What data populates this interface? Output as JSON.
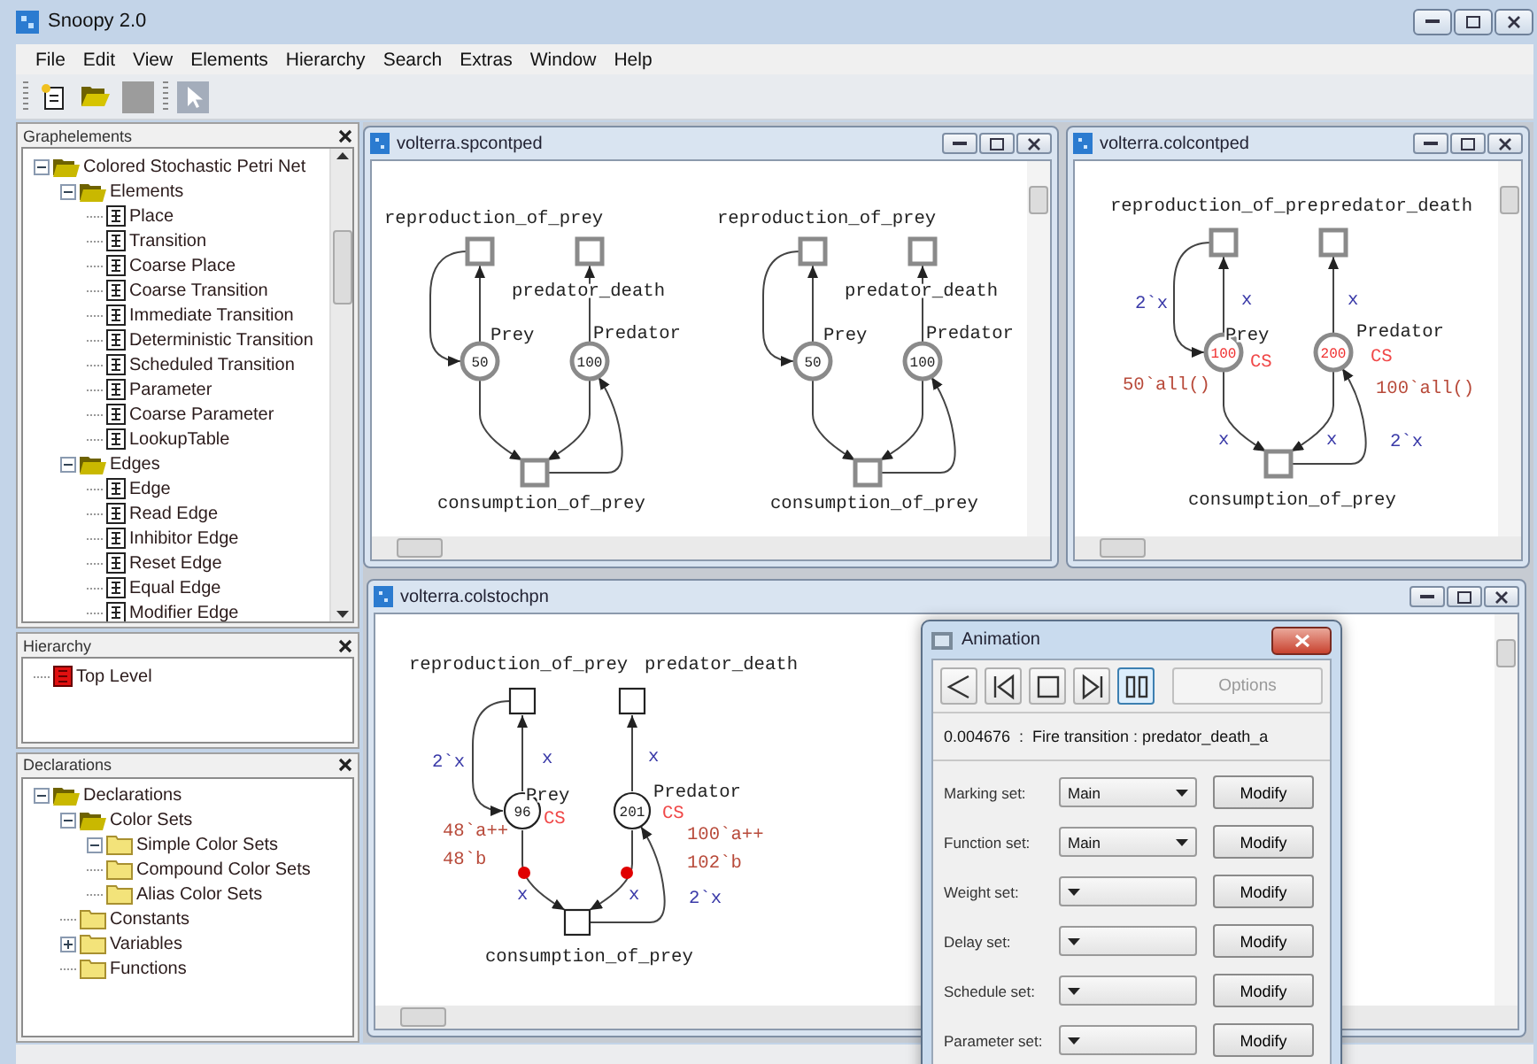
{
  "app": {
    "title": "Snoopy 2.0"
  },
  "menu": [
    "File",
    "Edit",
    "View",
    "Elements",
    "Hierarchy",
    "Search",
    "Extras",
    "Window",
    "Help"
  ],
  "toolbar": [
    {
      "kind": "new"
    },
    {
      "kind": "open"
    },
    {
      "kind": "save",
      "disabled": true
    },
    {
      "kind": "pointer"
    }
  ],
  "docks": [
    {
      "title": "Graphelements",
      "scrollable": true,
      "tree": [
        {
          "label": "Colored Stochastic Petri Net",
          "kind": "folder-open",
          "expanded": true,
          "children": [
            {
              "label": "Elements",
              "kind": "folder-open",
              "expanded": true,
              "children": [
                {
                  "label": "Place",
                  "kind": "doc"
                },
                {
                  "label": "Transition",
                  "kind": "doc"
                },
                {
                  "label": "Coarse Place",
                  "kind": "doc"
                },
                {
                  "label": "Coarse Transition",
                  "kind": "doc"
                },
                {
                  "label": "Immediate Transition",
                  "kind": "doc"
                },
                {
                  "label": "Deterministic Transition",
                  "kind": "doc"
                },
                {
                  "label": "Scheduled Transition",
                  "kind": "doc"
                },
                {
                  "label": "Parameter",
                  "kind": "doc"
                },
                {
                  "label": "Coarse Parameter",
                  "kind": "doc"
                },
                {
                  "label": "LookupTable",
                  "kind": "doc"
                }
              ]
            },
            {
              "label": "Edges",
              "kind": "folder-open",
              "expanded": true,
              "children": [
                {
                  "label": "Edge",
                  "kind": "doc"
                },
                {
                  "label": "Read Edge",
                  "kind": "doc"
                },
                {
                  "label": "Inhibitor Edge",
                  "kind": "doc"
                },
                {
                  "label": "Reset Edge",
                  "kind": "doc"
                },
                {
                  "label": "Equal Edge",
                  "kind": "doc"
                },
                {
                  "label": "Modifier Edge",
                  "kind": "doc"
                }
              ]
            }
          ]
        }
      ]
    },
    {
      "title": "Hierarchy",
      "tree": [
        {
          "label": "Top Level",
          "kind": "doc-red"
        }
      ]
    },
    {
      "title": "Declarations",
      "tree": [
        {
          "label": "Declarations",
          "kind": "folder-open",
          "expanded": true,
          "children": [
            {
              "label": "Color Sets",
              "kind": "folder-open",
              "expanded": true,
              "children": [
                {
                  "label": "Simple Color Sets",
                  "kind": "folder",
                  "expanded": true
                },
                {
                  "label": "Compound Color Sets",
                  "kind": "folder"
                },
                {
                  "label": "Alias Color Sets",
                  "kind": "folder"
                }
              ]
            },
            {
              "label": "Constants",
              "kind": "folder"
            },
            {
              "label": "Variables",
              "kind": "folder",
              "expanded": false
            },
            {
              "label": "Functions",
              "kind": "folder"
            }
          ]
        }
      ]
    }
  ],
  "windows": [
    {
      "title": "volterra.spcontped",
      "nets": [
        {
          "kind": "plain",
          "transitions": [
            "reproduction_of_prey",
            "predator_death",
            "consumption_of_prey"
          ],
          "places": [
            {
              "name": "Prey",
              "marking": "50"
            },
            {
              "name": "Predator",
              "marking": "100"
            }
          ]
        },
        {
          "kind": "plain",
          "transitions": [
            "reproduction_of_prey",
            "predator_death",
            "consumption_of_prey"
          ],
          "places": [
            {
              "name": "Prey",
              "marking": "50"
            },
            {
              "name": "Predator",
              "marking": "100"
            }
          ]
        }
      ]
    },
    {
      "title": "volterra.colcontped",
      "nets": [
        {
          "kind": "colored",
          "transitions": [
            "reproduction_of_pre",
            "predator_death",
            "consumption_of_prey"
          ],
          "places": [
            {
              "name": "Prey",
              "marking": "100",
              "color_set": "CS",
              "initial": [
                "50`all()"
              ]
            },
            {
              "name": "Predator",
              "marking": "200",
              "color_set": "CS",
              "initial": [
                "100`all()"
              ]
            }
          ],
          "arc_inscriptions": [
            "2`x",
            "x",
            "x",
            "x",
            "x",
            "2`x"
          ]
        }
      ]
    },
    {
      "title": "volterra.colstochpn",
      "nets": [
        {
          "kind": "stochastic",
          "tokens_in_transit": true,
          "transitions": [
            "reproduction_of_prey",
            "predator_death",
            "consumption_of_prey"
          ],
          "places": [
            {
              "name": "Prey",
              "marking": "96",
              "color_set": "CS",
              "initial": [
                "48`a++",
                "48`b"
              ]
            },
            {
              "name": "Predator",
              "marking": "201",
              "color_set": "CS",
              "initial": [
                "100`a++",
                "102`b"
              ]
            }
          ],
          "arc_inscriptions": [
            "2`x",
            "x",
            "x",
            "x",
            "x",
            "2`x"
          ]
        }
      ]
    }
  ],
  "animation": {
    "title": "Animation",
    "controls": [
      {
        "kind": "back",
        "selected": false
      },
      {
        "kind": "step-back",
        "selected": false
      },
      {
        "kind": "stop",
        "selected": false
      },
      {
        "kind": "step-forward",
        "selected": false
      },
      {
        "kind": "pause",
        "selected": true
      }
    ],
    "options": {
      "label": "Options",
      "disabled": true
    },
    "status": "0.004676  :  Fire transition : predator_death_a",
    "sets": [
      {
        "label": "Marking set:",
        "value": "Main",
        "button": "Modify"
      },
      {
        "label": "Function set:",
        "value": "Main",
        "button": "Modify"
      },
      {
        "label": "Weight set:",
        "button": "Modify"
      },
      {
        "label": "Delay set:",
        "button": "Modify"
      },
      {
        "label": "Schedule set:",
        "button": "Modify"
      },
      {
        "label": "Parameter set:",
        "button": "Modify"
      }
    ]
  }
}
